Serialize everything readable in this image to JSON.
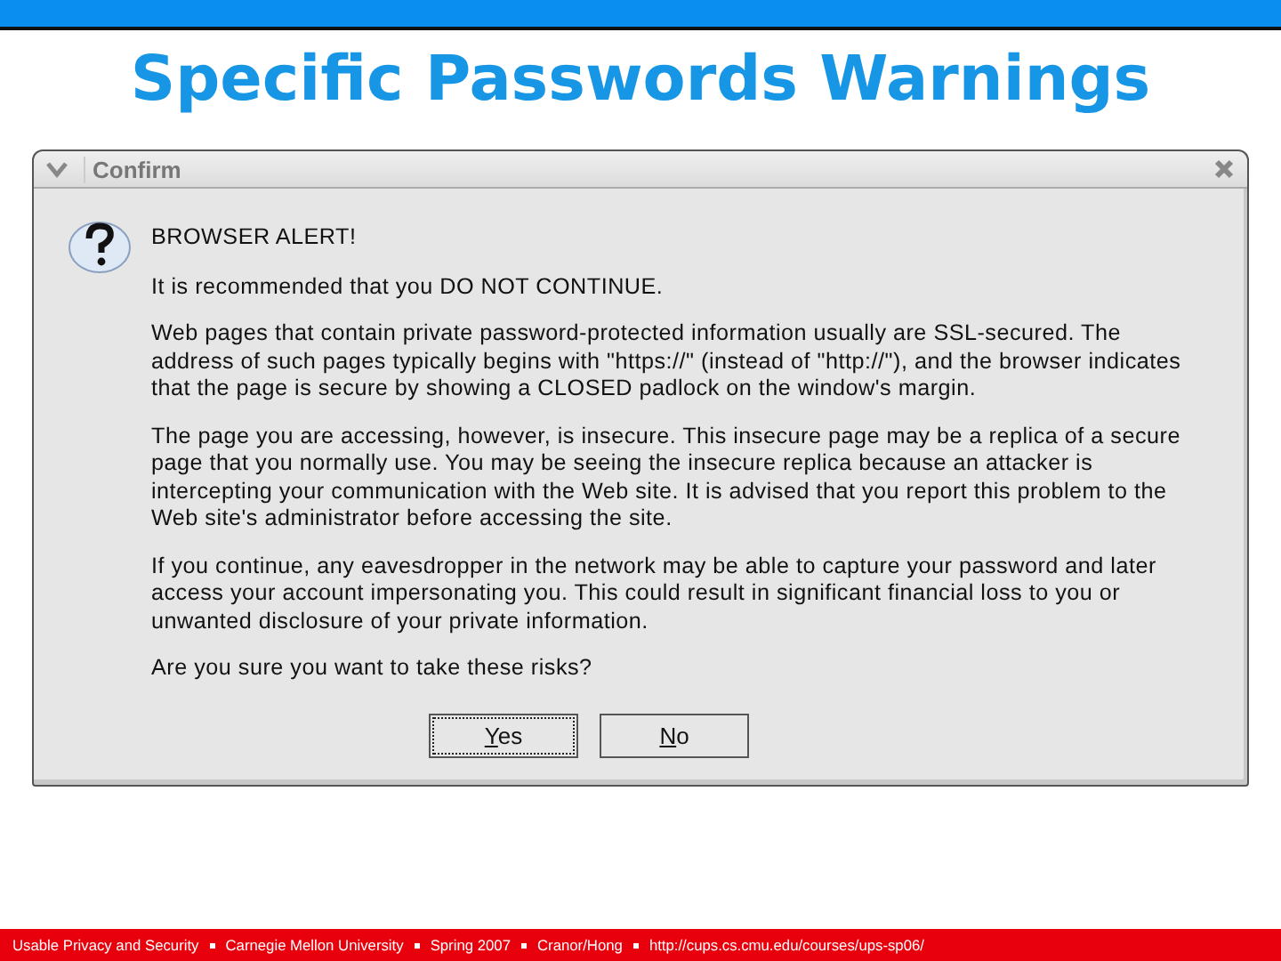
{
  "slide": {
    "title": "Specific Passwords Warnings"
  },
  "dialog": {
    "title": "Confirm",
    "heading": "BROWSER ALERT!",
    "paragraphs": [
      "It is recommended that you DO NOT CONTINUE.",
      "Web pages that contain private password-protected information usually are SSL-secured. The address of such pages typically begins with \"https://\" (instead of \"http://\"), and the browser indicates that the page is secure by showing a CLOSED padlock on the window's margin.",
      "The page you are accessing, however, is insecure. This insecure page may be a replica of a secure page that you normally use. You may be seeing the insecure replica because an attacker is intercepting your communication with the Web site. It is advised that you report this problem to the Web site's administrator before accessing the site.",
      "If you continue, any eavesdropper in the network may be able to capture your password and later access your account impersonating you. This could result in significant financial loss to you or unwanted disclosure of your private information.",
      "Are you sure you want to take these risks?"
    ],
    "buttons": [
      {
        "label": "Yes",
        "focused": true
      },
      {
        "label": "No",
        "focused": false
      }
    ]
  },
  "footer": [
    "Usable Privacy and Security",
    "Carnegie Mellon University",
    "Spring 2007",
    "Cranor/Hong",
    "http://cups.cs.cmu.edu/courses/ups-sp06/"
  ]
}
